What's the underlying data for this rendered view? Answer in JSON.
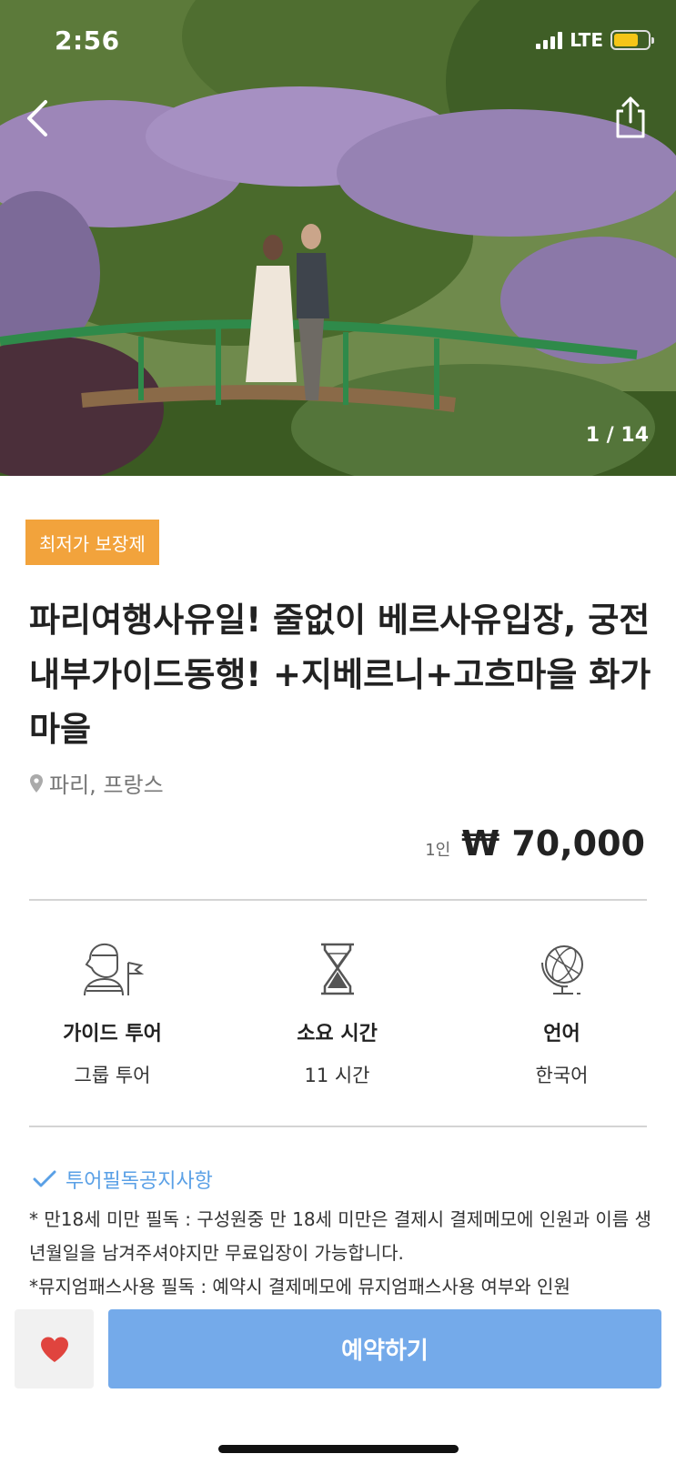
{
  "status_bar": {
    "time": "2:56",
    "network": "LTE"
  },
  "hero": {
    "image_counter": "1 / 14",
    "back_icon": "chevron-left-icon",
    "share_icon": "share-icon"
  },
  "product": {
    "badge": "최저가 보장제",
    "title": " 파리여행사유일! 줄없이 베르사유입장, 궁전내부가이드동행! +지베르니+고흐마을 화가마을",
    "location": "파리, 프랑스",
    "price_unit": "1인",
    "price": "₩ 70,000",
    "badge_color": "#f2a33c"
  },
  "features": [
    {
      "icon": "guide-icon",
      "label": "가이드 투어",
      "value": "그룹 투어"
    },
    {
      "icon": "hourglass-icon",
      "label": "소요 시간",
      "value": "11 시간"
    },
    {
      "icon": "globe-icon",
      "label": "언어",
      "value": "한국어"
    }
  ],
  "notice": {
    "heading": "투어필독공지사항",
    "lines": [
      "* 만18세 미만 필독 : 구성원중 만 18세 미만은 결제시 결제메모에 인원과 이름 생년월일을 남겨주셔야지만 무료입장이 가능합니다.",
      "*뮤지엄패스사용 필독 : 예약시 결제메모에 뮤지엄패스사용 여부와 인원"
    ]
  },
  "bottom_bar": {
    "favorite_icon": "heart-icon",
    "book_label": "예약하기",
    "book_color": "#74aaea",
    "heart_color": "#e0443e"
  }
}
